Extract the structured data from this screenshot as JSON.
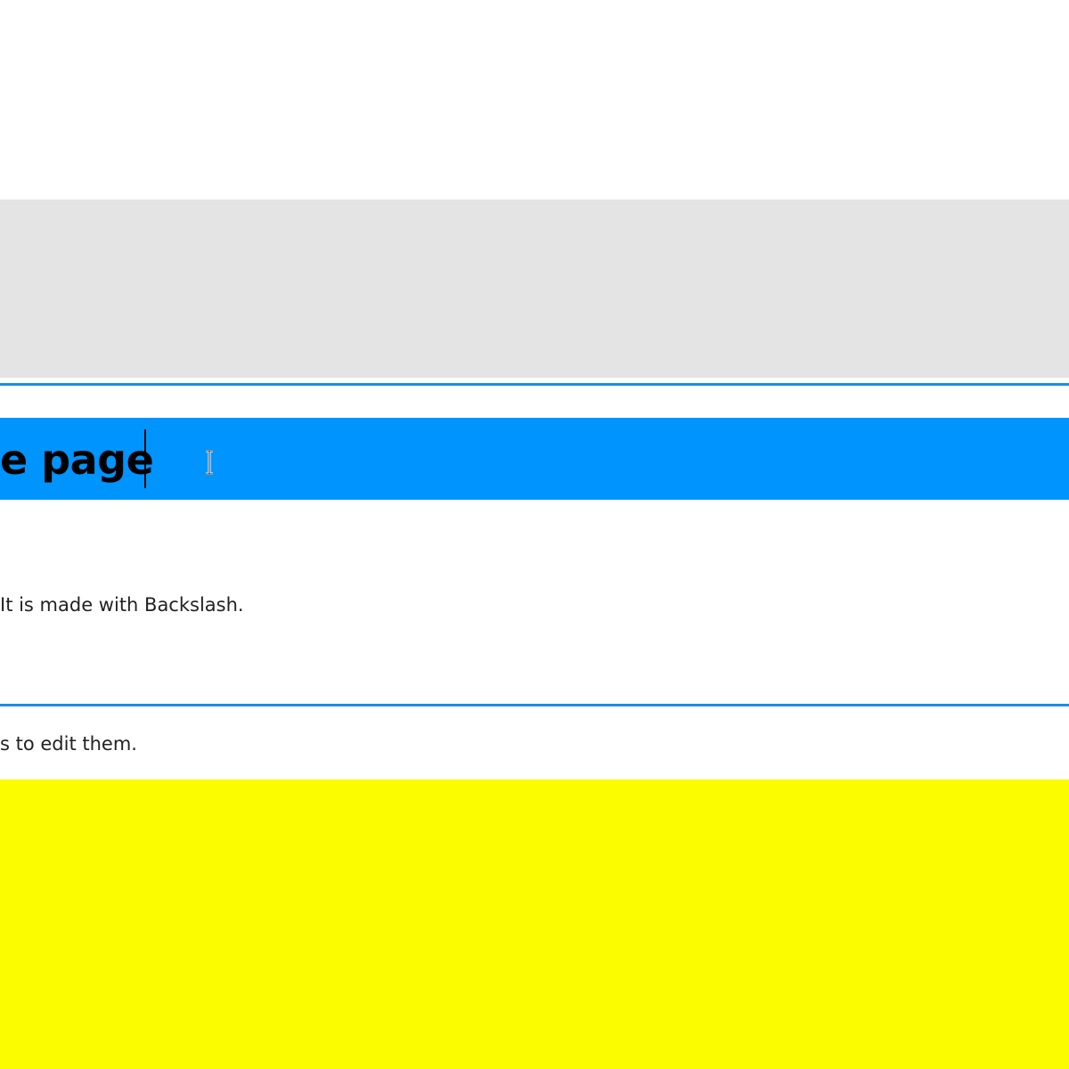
{
  "hero": {
    "heading_text": "e page"
  },
  "content": {
    "paragraph_1": "It is made with Backslash.",
    "paragraph_2": "s to edit them."
  },
  "cursor": {
    "icon": "text-ibeam-cursor-icon"
  },
  "colors": {
    "gray_band": "#e4e4e4",
    "selection_rule": "#1a8fe6",
    "heading_band": "#0094ff",
    "yellow_block": "#fcfc00",
    "text": "#222222"
  }
}
